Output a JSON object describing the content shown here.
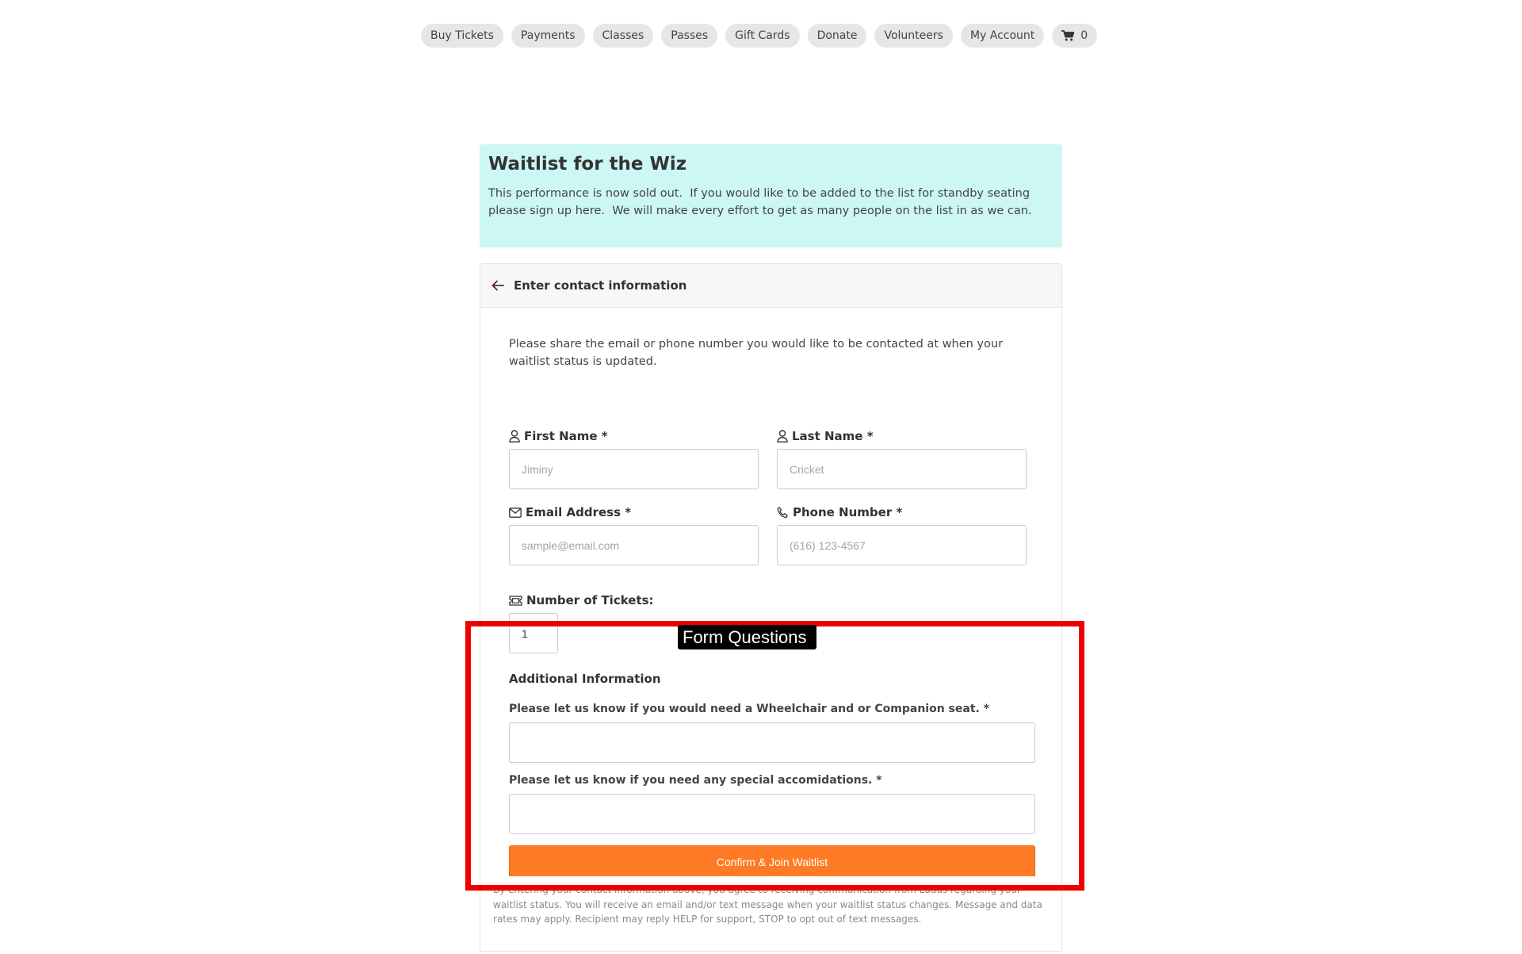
{
  "nav": {
    "items": [
      {
        "label": "Buy Tickets"
      },
      {
        "label": "Payments"
      },
      {
        "label": "Classes"
      },
      {
        "label": "Passes"
      },
      {
        "label": "Gift Cards"
      },
      {
        "label": "Donate"
      },
      {
        "label": "Volunteers"
      },
      {
        "label": "My Account"
      }
    ],
    "cart": {
      "icon": "cart-icon",
      "count": "0"
    }
  },
  "info": {
    "title": "Waitlist for the Wiz",
    "text": "This performance is now sold out.  If you would like to be added to the list for standby seating please sign up here.  We will make every effort to get as many people on the list in as we can."
  },
  "card": {
    "header": {
      "back_icon": "arrow-left-icon",
      "title": "Enter contact information"
    },
    "intro": "Please share the email or phone number you would like to be contacted at when your waitlist status is updated.",
    "fields": {
      "first_name": {
        "icon": "user-icon",
        "label": "First Name *",
        "placeholder": "Jiminy",
        "value": ""
      },
      "last_name": {
        "icon": "user-icon",
        "label": "Last Name *",
        "placeholder": "Cricket",
        "value": ""
      },
      "email": {
        "icon": "envelope-icon",
        "label": "Email Address *",
        "placeholder": "sample@email.com",
        "value": ""
      },
      "phone": {
        "icon": "phone-icon",
        "label": "Phone Number *",
        "placeholder": "(616) 123-4567",
        "value": ""
      },
      "tickets": {
        "icon": "ticket-icon",
        "label": "Number of Tickets:",
        "value": "1"
      }
    },
    "additional": {
      "title": "Additional Information",
      "questions": [
        {
          "label": "Please let us know if you would need a Wheelchair and or Companion seat. *",
          "value": ""
        },
        {
          "label": "Please let us know if you need any special accomidations. *",
          "value": ""
        }
      ]
    },
    "submit_label": "Confirm & Join Waitlist",
    "footer_note": "By entering your contact information above, you agree to receiving communication from Ludus regarding your waitlist status. You will receive an email and/or text message when your waitlist status changes. Message and data rates may apply. Recipient may reply HELP for support, STOP to opt out of text messages."
  },
  "annotation": {
    "label": "Form Questions",
    "color": "#ee0000"
  },
  "colors": {
    "accent_button": "#ff7a24",
    "info_background": "#cdf7f4"
  }
}
